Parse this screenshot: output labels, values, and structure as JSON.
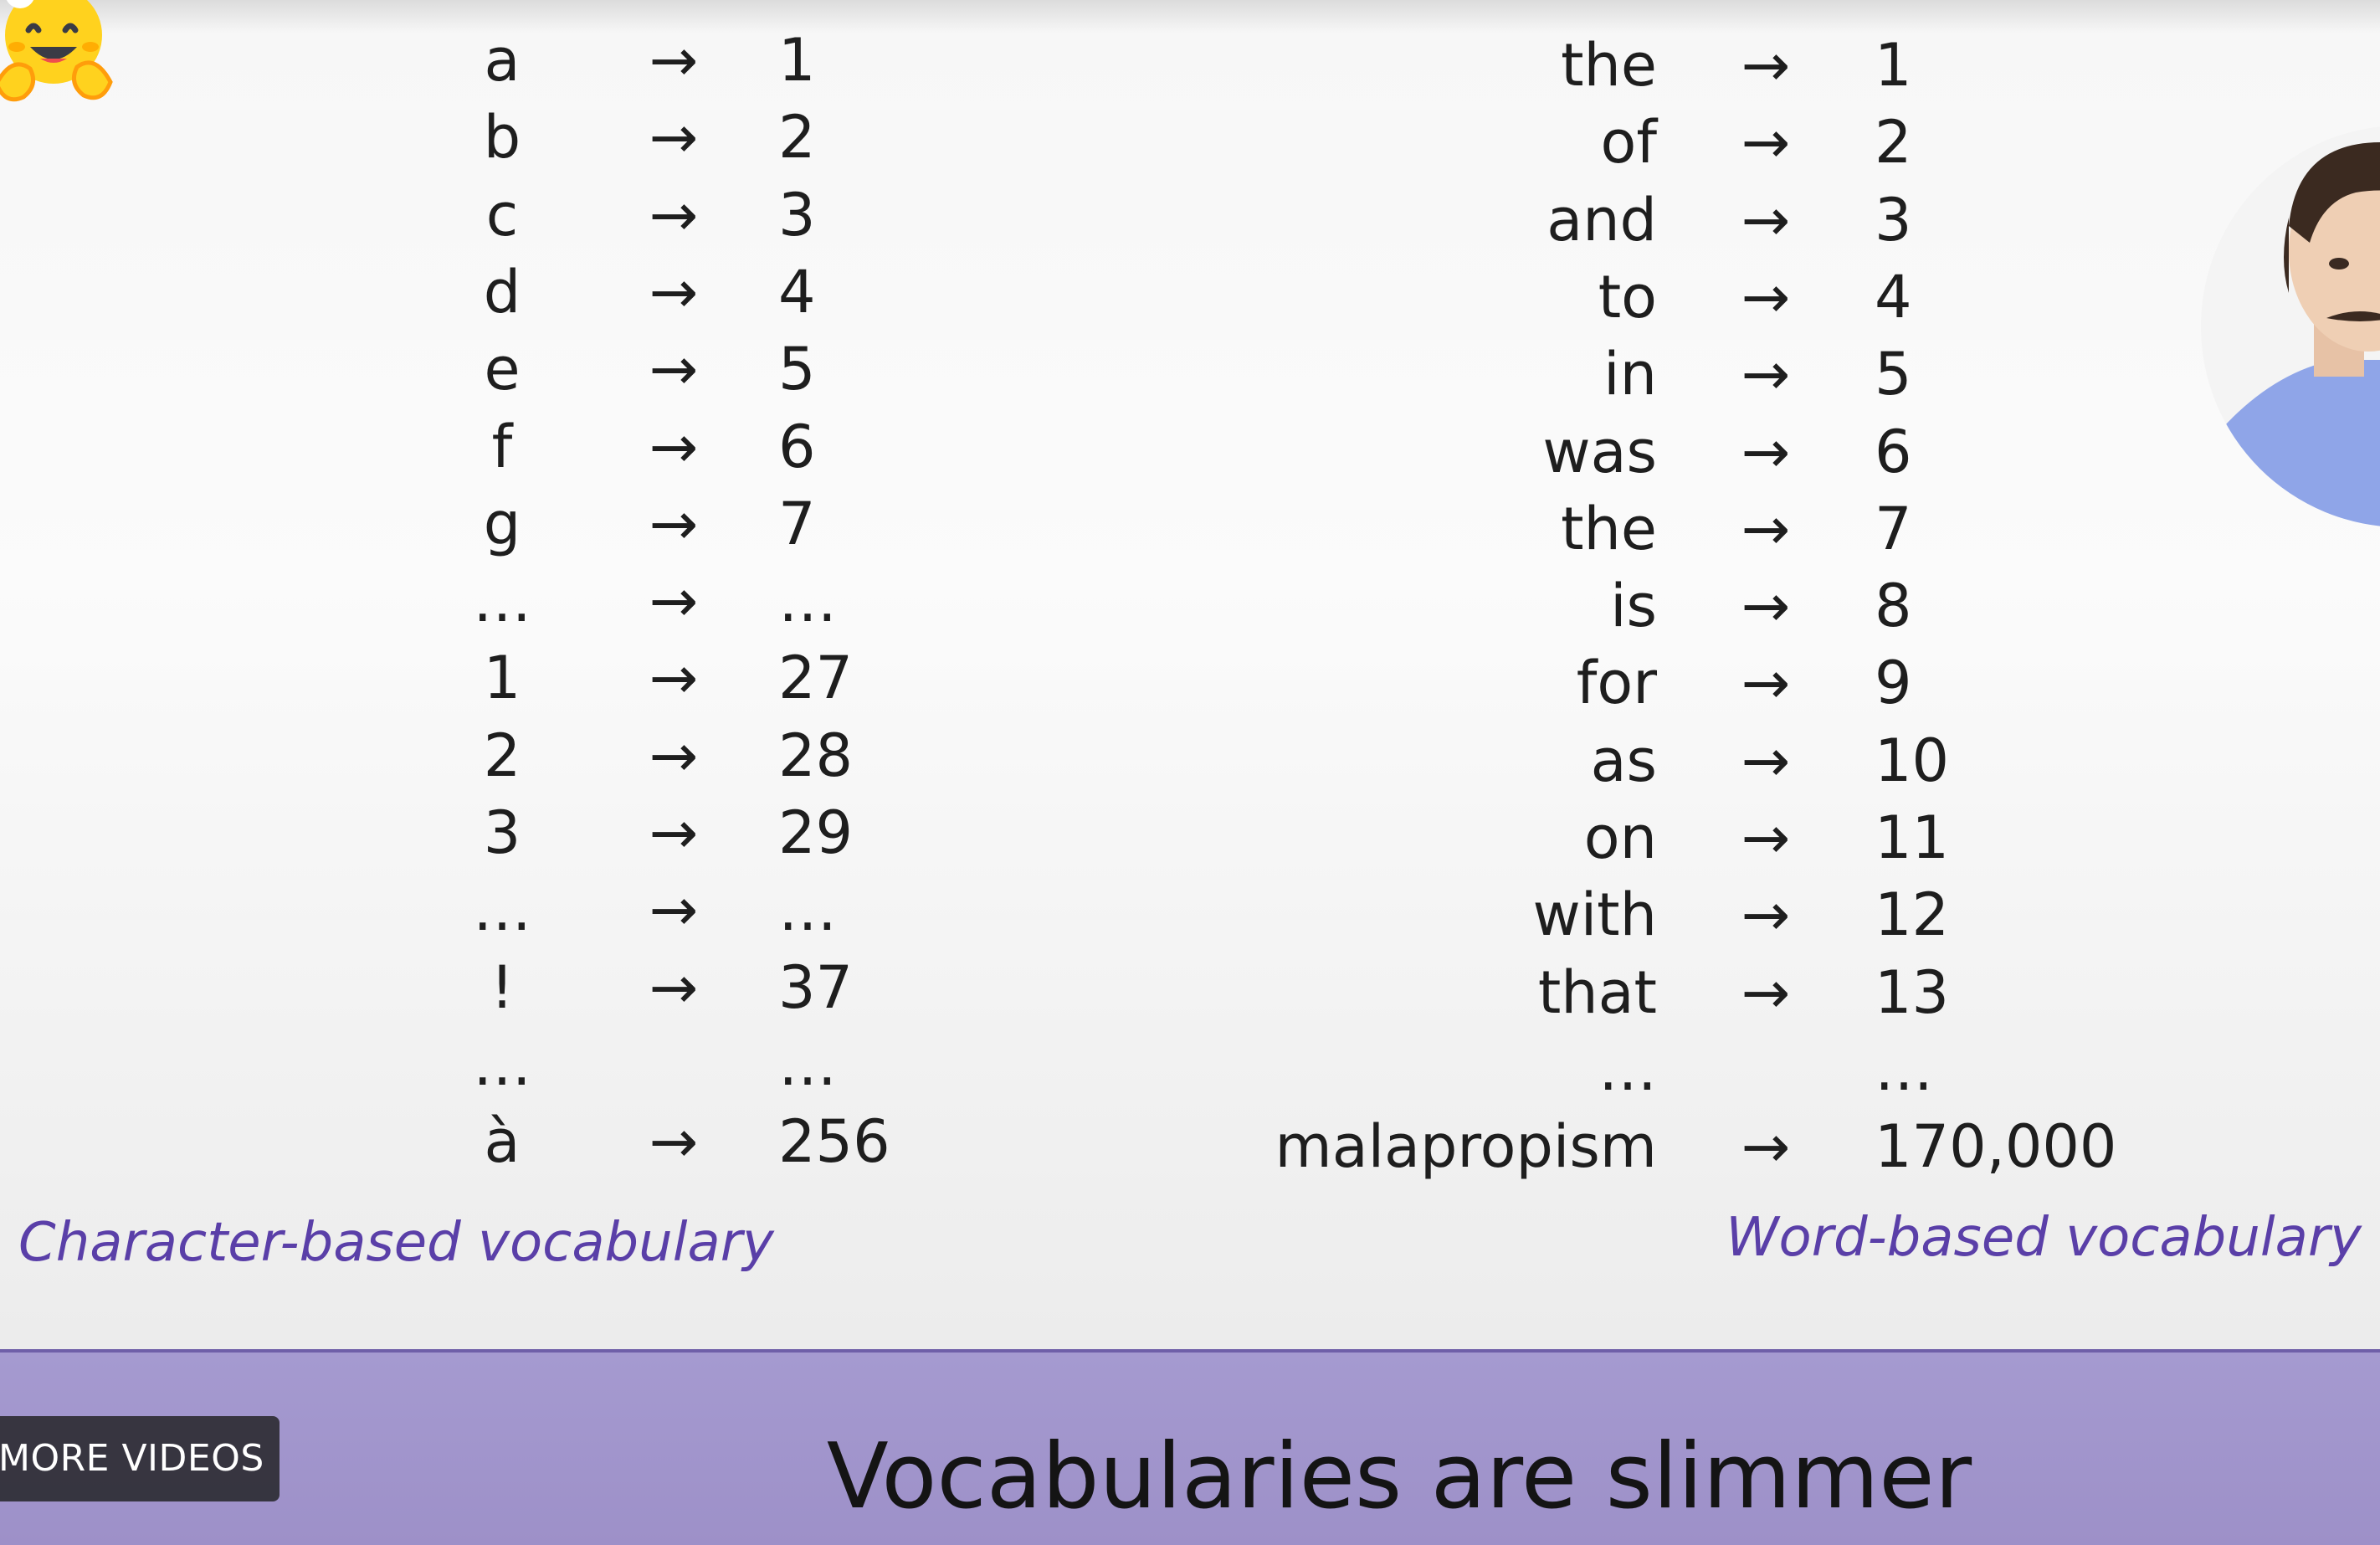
{
  "char_vocab": {
    "rows": [
      {
        "token": "a",
        "arrow": "→",
        "id": "1"
      },
      {
        "token": "b",
        "arrow": "→",
        "id": "2"
      },
      {
        "token": "c",
        "arrow": "→",
        "id": "3"
      },
      {
        "token": "d",
        "arrow": "→",
        "id": "4"
      },
      {
        "token": "e",
        "arrow": "→",
        "id": "5"
      },
      {
        "token": "f",
        "arrow": "→",
        "id": "6"
      },
      {
        "token": "g",
        "arrow": "→",
        "id": "7"
      },
      {
        "token": "…",
        "arrow": "→",
        "id": "…"
      },
      {
        "token": "1",
        "arrow": "→",
        "id": "27"
      },
      {
        "token": "2",
        "arrow": "→",
        "id": "28"
      },
      {
        "token": "3",
        "arrow": "→",
        "id": "29"
      },
      {
        "token": "…",
        "arrow": "→",
        "id": "…"
      },
      {
        "token": "!",
        "arrow": "→",
        "id": "37"
      },
      {
        "token": "…",
        "arrow": "",
        "id": "…"
      },
      {
        "token": "à",
        "arrow": "→",
        "id": "256"
      }
    ],
    "caption": "Character-based vocabulary"
  },
  "word_vocab": {
    "rows": [
      {
        "token": "the",
        "arrow": "→",
        "id": "1"
      },
      {
        "token": "of",
        "arrow": "→",
        "id": "2"
      },
      {
        "token": "and",
        "arrow": "→",
        "id": "3"
      },
      {
        "token": "to",
        "arrow": "→",
        "id": "4"
      },
      {
        "token": "in",
        "arrow": "→",
        "id": "5"
      },
      {
        "token": "was",
        "arrow": "→",
        "id": "6"
      },
      {
        "token": "the",
        "arrow": "→",
        "id": "7"
      },
      {
        "token": "is",
        "arrow": "→",
        "id": "8"
      },
      {
        "token": "for",
        "arrow": "→",
        "id": "9"
      },
      {
        "token": "as",
        "arrow": "→",
        "id": "10"
      },
      {
        "token": "on",
        "arrow": "→",
        "id": "11"
      },
      {
        "token": "with",
        "arrow": "→",
        "id": "12"
      },
      {
        "token": "that",
        "arrow": "→",
        "id": "13"
      },
      {
        "token": "…",
        "arrow": "",
        "id": "…"
      },
      {
        "token": "malapropism",
        "arrow": "→",
        "id": "170,000"
      }
    ],
    "caption": "Word-based vocabulary"
  },
  "banner": {
    "title": "Vocabularies are slimmer",
    "more_videos_label": "MORE VIDEOS"
  },
  "icons": {
    "logo": "hugging-face-logo",
    "presenter": "presenter-webcam"
  },
  "colors": {
    "caption": "#5a3fa8",
    "banner": "#a59ad0",
    "text": "#1e1e1e"
  }
}
